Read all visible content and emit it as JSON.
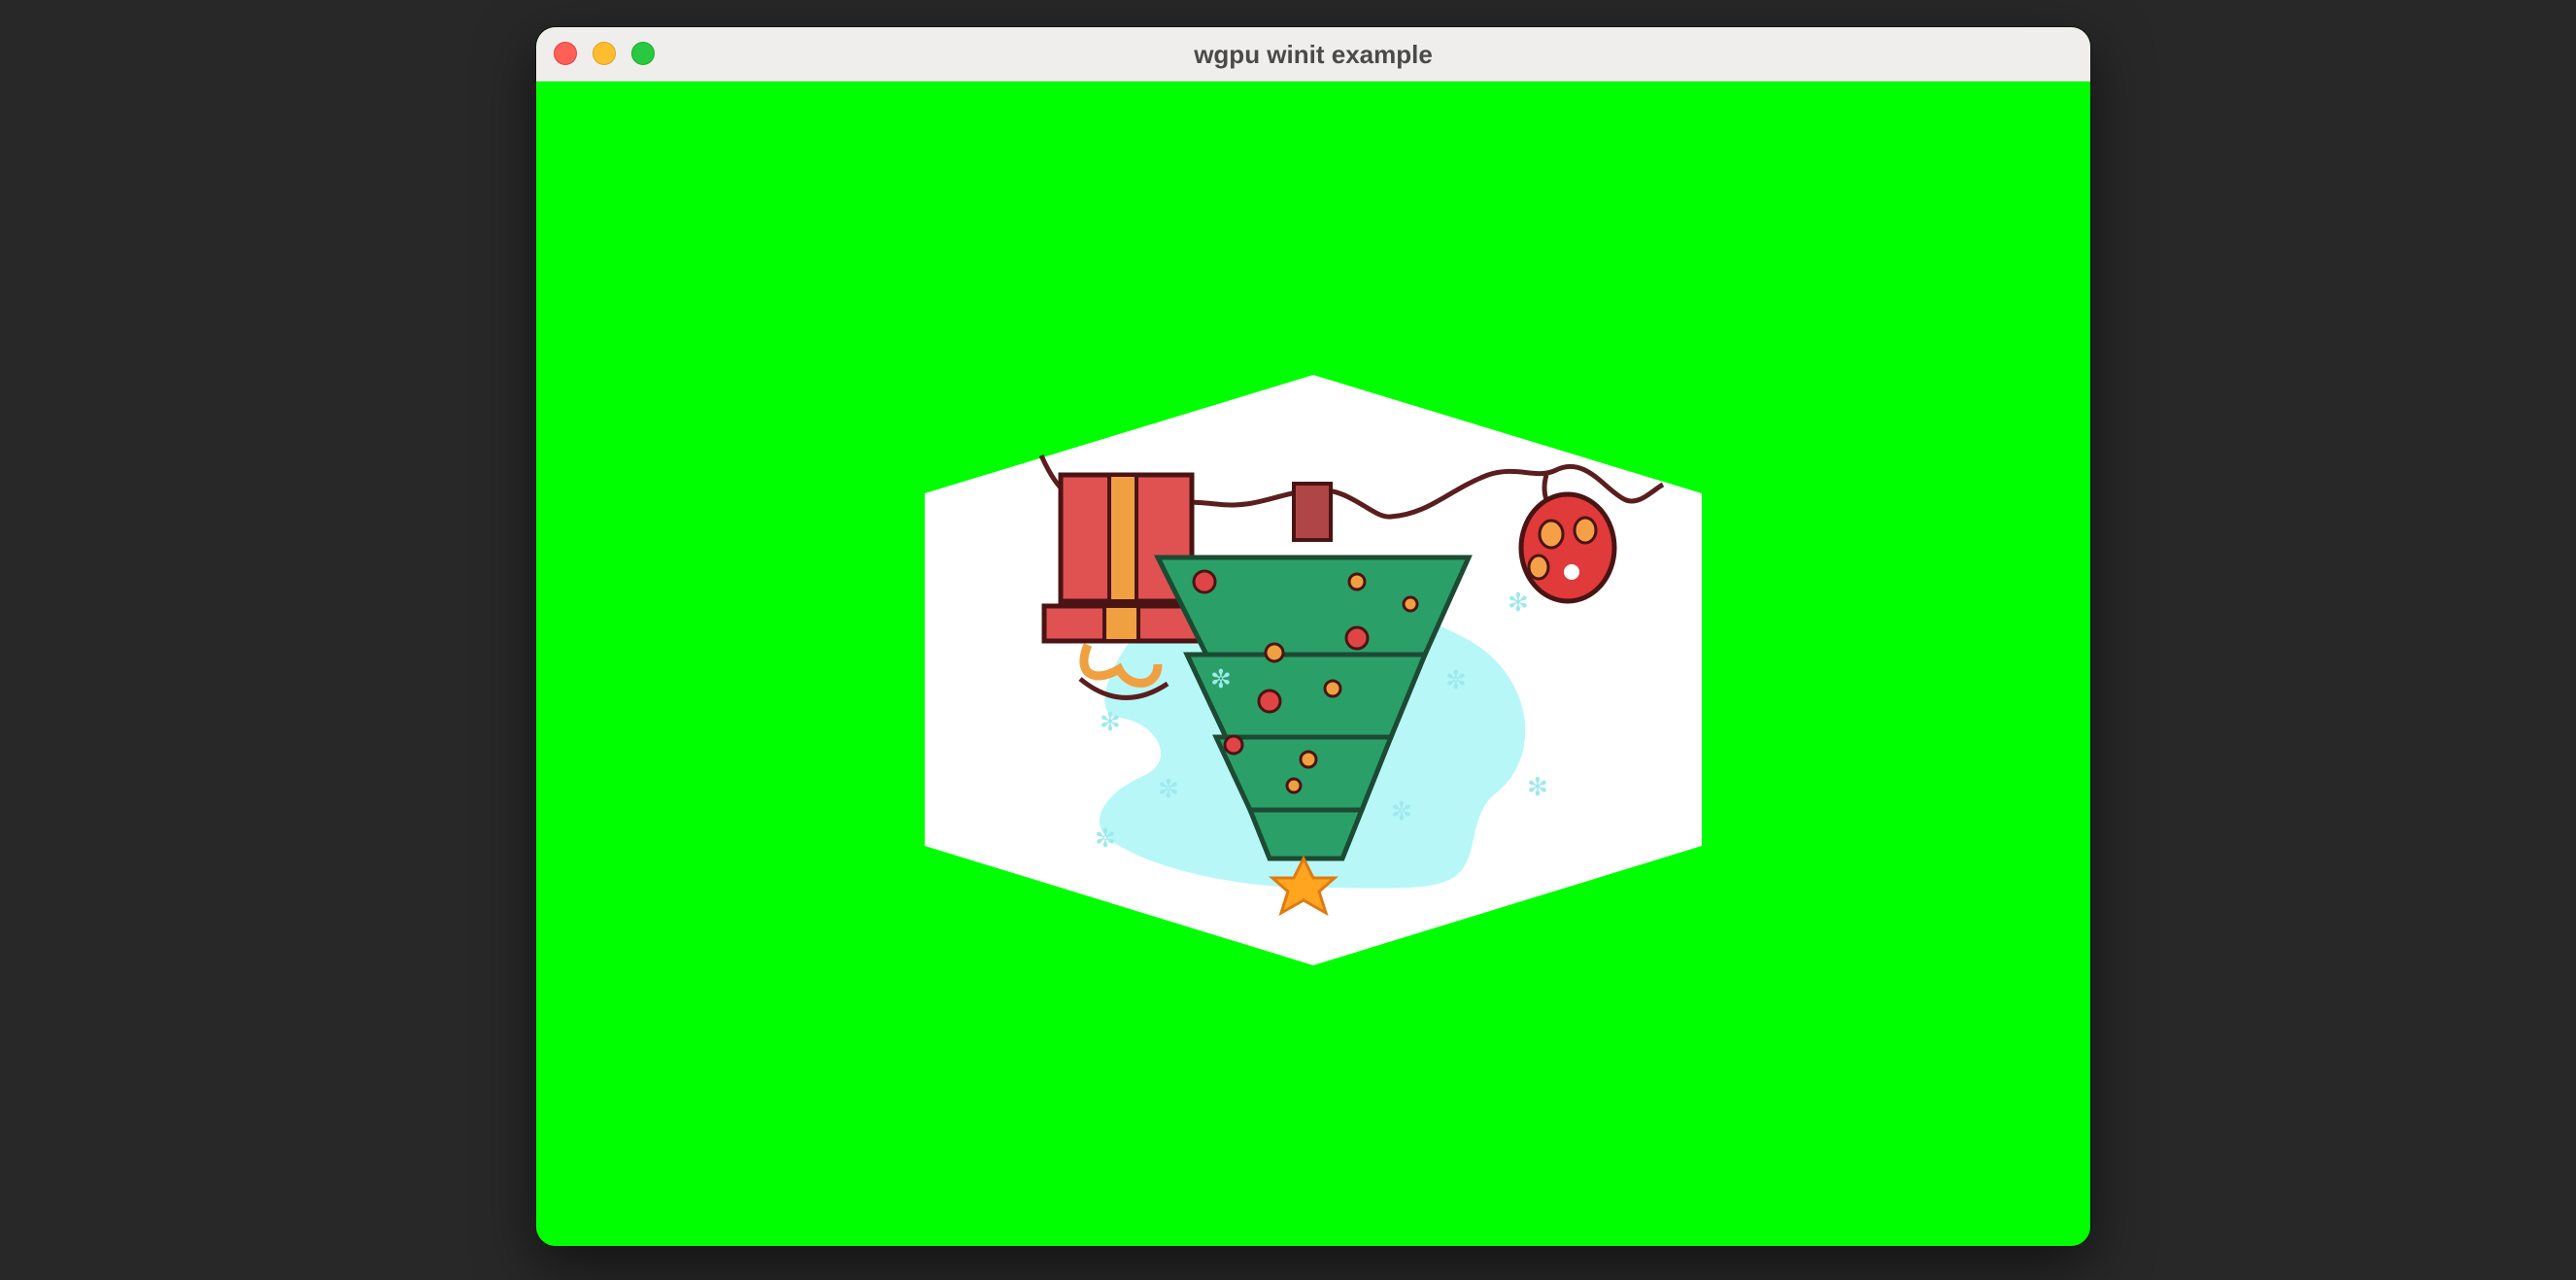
{
  "window": {
    "title": "wgpu winit example",
    "controls": {
      "close": "close-button",
      "minimize": "minimize-button",
      "zoom": "zoom-button"
    }
  },
  "colors": {
    "desktop": "#282828",
    "clear_color": "#00ff00",
    "titlebar": "#efeeec",
    "close": "#ff5f57",
    "minimize": "#febc2e",
    "zoom": "#28c840"
  },
  "scene": {
    "object": "cube",
    "texture": "christmas-tree-illustration"
  }
}
